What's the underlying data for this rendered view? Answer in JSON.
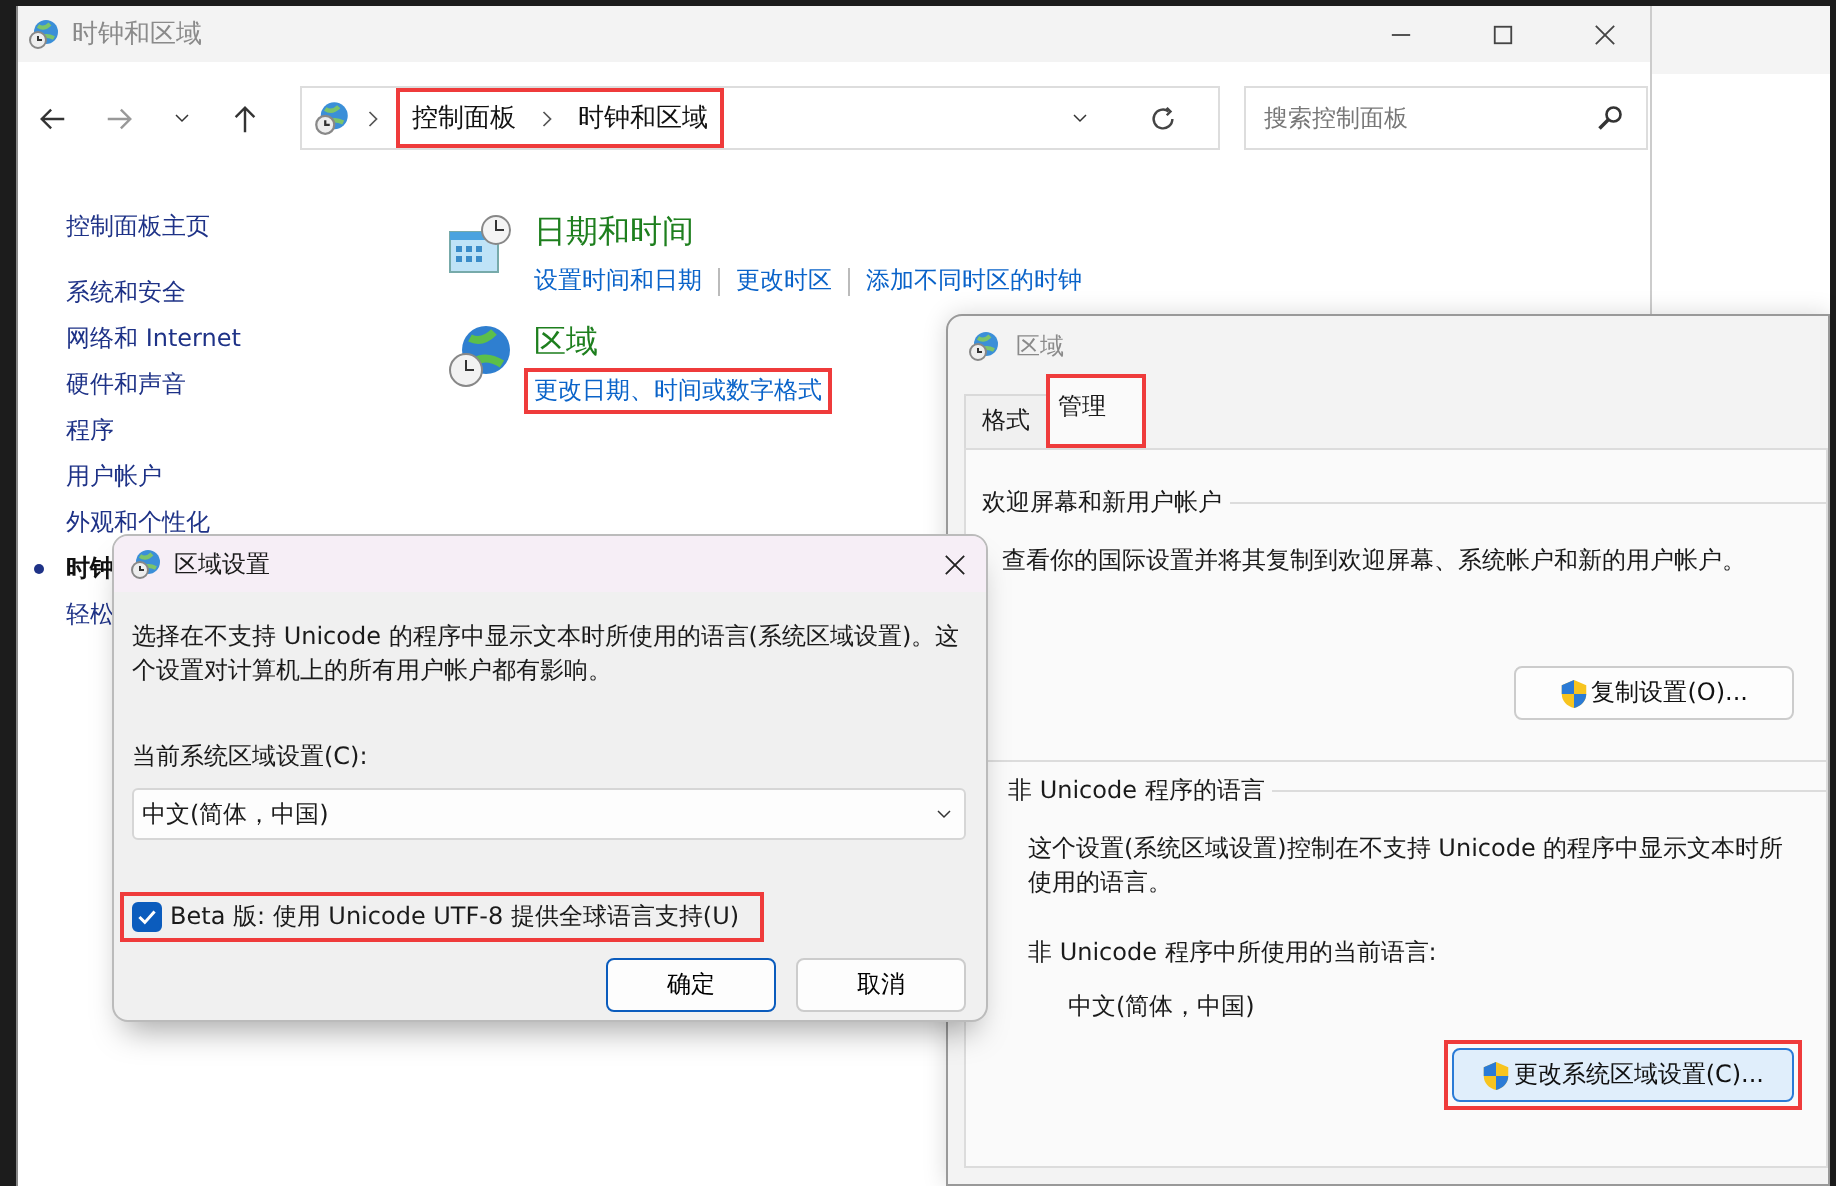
{
  "main_window": {
    "title": "时钟和区域",
    "address": {
      "highlighted": true,
      "breadcrumb": [
        {
          "label": "控制面板"
        },
        {
          "label": "时钟和区域"
        }
      ]
    },
    "search": {
      "placeholder": "搜索控制面板"
    },
    "sidebar": {
      "items": [
        {
          "label": "控制面板主页",
          "selected": false
        },
        {
          "label": "系统和安全",
          "selected": false
        },
        {
          "label": "网络和 Internet",
          "selected": false
        },
        {
          "label": "硬件和声音",
          "selected": false
        },
        {
          "label": "程序",
          "selected": false
        },
        {
          "label": "用户帐户",
          "selected": false
        },
        {
          "label": "外观和个性化",
          "selected": false
        },
        {
          "label": "时钟",
          "selected": true
        },
        {
          "label": "轻松",
          "selected": false
        }
      ]
    },
    "categories": [
      {
        "kind": "datetime",
        "title": "日期和时间",
        "links": [
          {
            "label": "设置时间和日期",
            "highlighted": false
          },
          {
            "label": "更改时区",
            "highlighted": false
          },
          {
            "label": "添加不同时区的时钟",
            "highlighted": false
          }
        ]
      },
      {
        "kind": "region",
        "title": "区域",
        "links": [
          {
            "label": "更改日期、时间或数字格式",
            "highlighted": true
          }
        ]
      }
    ]
  },
  "region_window": {
    "title": "区域",
    "tabs": [
      {
        "label": "格式",
        "selected": false,
        "highlighted": false
      },
      {
        "label": "管理",
        "selected": true,
        "highlighted": true
      }
    ],
    "groups": [
      {
        "title": "欢迎屏幕和新用户帐户",
        "text": "查看你的国际设置并将其复制到欢迎屏幕、系统帐户和新的用户帐户。",
        "button": {
          "label": "复制设置(O)...",
          "highlighted": false
        }
      },
      {
        "title": "非 Unicode 程序的语言",
        "text": "这个设置(系统区域设置)控制在不支持 Unicode 的程序中显示文本时所使用的语言。",
        "label": "非 Unicode 程序中所使用的当前语言:",
        "value": "中文(简体，中国)",
        "button": {
          "label": "更改系统区域设置(C)...",
          "highlighted": true
        }
      }
    ]
  },
  "locale_dialog": {
    "title": "区域设置",
    "description": "选择在不支持 Unicode 的程序中显示文本时所使用的语言(系统区域设置)。这个设置对计算机上的所有用户帐户都有影响。",
    "select_label": "当前系统区域设置(C):",
    "select_value": "中文(简体，中国)",
    "checkbox": {
      "label": "Beta 版: 使用 Unicode UTF-8 提供全球语言支持(U)",
      "checked": true,
      "highlighted": true
    },
    "buttons": [
      {
        "label": "确定",
        "default": true
      },
      {
        "label": "取消",
        "default": false
      }
    ]
  }
}
